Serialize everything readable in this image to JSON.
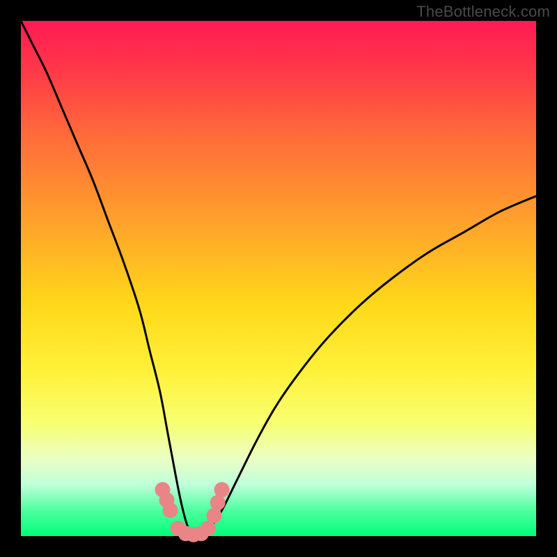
{
  "watermark": "TheBottleneck.com",
  "chart_data": {
    "type": "line",
    "title": "",
    "xlabel": "",
    "ylabel": "",
    "xlim": [
      0,
      100
    ],
    "ylim": [
      0,
      100
    ],
    "x": [
      0,
      2,
      5,
      8,
      11,
      14,
      17,
      20,
      23,
      25,
      27,
      28.5,
      30,
      31,
      32,
      33,
      34,
      35.5,
      37,
      39,
      42,
      46,
      50,
      55,
      60,
      66,
      72,
      79,
      86,
      93,
      100
    ],
    "values": [
      100,
      96,
      90,
      83,
      76,
      69,
      61,
      53,
      44,
      36,
      28,
      20,
      12,
      7,
      3,
      0.5,
      0,
      0.5,
      2,
      5,
      11,
      19,
      26,
      33,
      39,
      45,
      50,
      55,
      59,
      63,
      66
    ],
    "markers": {
      "x": [
        27.5,
        28.3,
        29.0,
        30.5,
        32.0,
        33.5,
        35.0,
        36.3,
        37.5,
        38.2,
        39.0
      ],
      "y": [
        9,
        7,
        5,
        1.5,
        0.5,
        0.3,
        0.5,
        1.5,
        4,
        6.5,
        9
      ]
    },
    "background_gradient": {
      "top": "#ff1a54",
      "mid1": "#ffa52a",
      "mid2": "#fff13a",
      "bottom": "#00ff78"
    },
    "curve_color": "#000000",
    "marker_color": "#e98586"
  }
}
